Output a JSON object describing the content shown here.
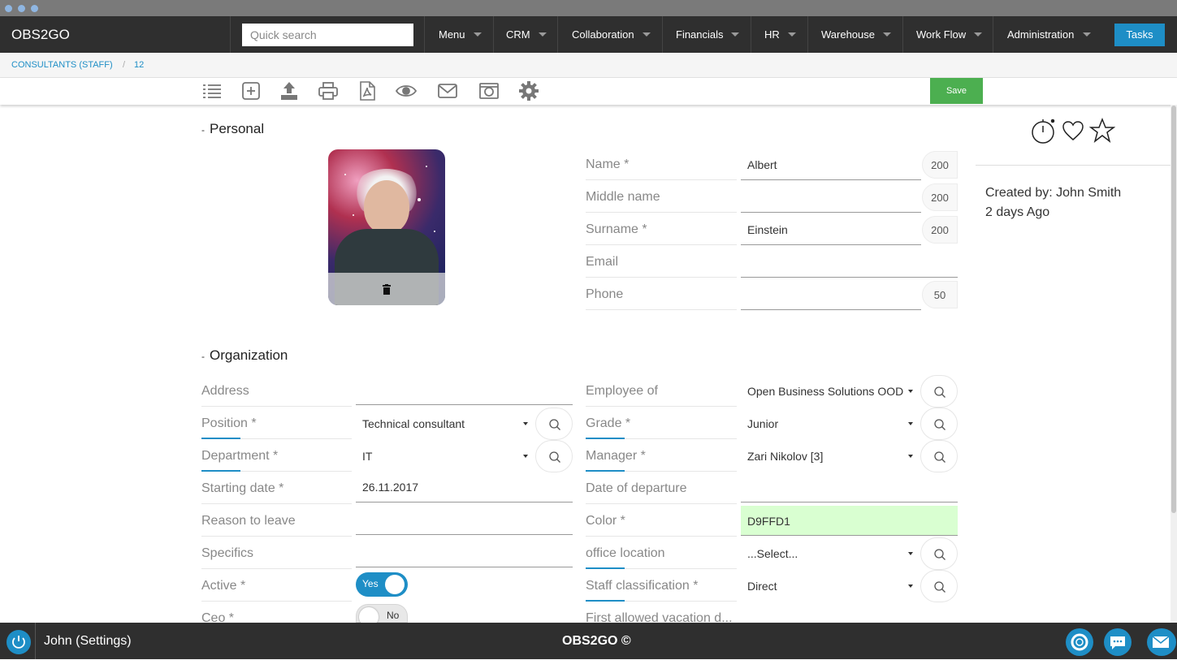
{
  "app": {
    "brand": "OBS2GO"
  },
  "search": {
    "placeholder": "Quick search"
  },
  "nav": {
    "items": [
      {
        "label": "Menu"
      },
      {
        "label": "CRM"
      },
      {
        "label": "Collaboration"
      },
      {
        "label": "Financials"
      },
      {
        "label": "HR"
      },
      {
        "label": "Warehouse"
      },
      {
        "label": "Work Flow"
      },
      {
        "label": "Administration"
      }
    ],
    "tasks_label": "Tasks"
  },
  "breadcrumb": {
    "items": [
      "CONSULTANTS (STAFF)",
      "12"
    ],
    "separator": "/"
  },
  "toolbar": {
    "icons": [
      "list-icon",
      "add-icon",
      "upload-icon",
      "print-icon",
      "pdf-icon",
      "view-icon",
      "email-icon",
      "photo-icon",
      "settings-icon"
    ],
    "save_label": "Save"
  },
  "personal": {
    "title": "Personal",
    "collapse_symbol": "-",
    "fields": {
      "name": {
        "label": "Name *",
        "value": "Albert",
        "counter": "200"
      },
      "middle": {
        "label": "Middle name",
        "value": "",
        "counter": "200"
      },
      "surname": {
        "label": "Surname *",
        "value": "Einstein",
        "counter": "200"
      },
      "email": {
        "label": "Email",
        "value": ""
      },
      "phone": {
        "label": "Phone",
        "value": "",
        "counter": "50"
      }
    }
  },
  "organization": {
    "title": "Organization",
    "collapse_symbol": "-",
    "left": {
      "address": {
        "label": "Address",
        "value": ""
      },
      "position": {
        "label": "Position *",
        "value": "Technical consultant"
      },
      "department": {
        "label": "Department *",
        "value": "IT"
      },
      "starting_date": {
        "label": "Starting date *",
        "value": "26.11.2017"
      },
      "reason": {
        "label": "Reason to leave",
        "value": ""
      },
      "specifics": {
        "label": "Specifics",
        "value": ""
      },
      "active": {
        "label": "Active *",
        "value": "Yes"
      },
      "ceo": {
        "label": "Ceo *",
        "value": "No"
      }
    },
    "right": {
      "employee_of": {
        "label": "Employee of",
        "value": "Open Business Solutions OOD"
      },
      "grade": {
        "label": "Grade *",
        "value": "Junior"
      },
      "manager": {
        "label": "Manager *",
        "value": "Zari Nikolov [3]"
      },
      "departure": {
        "label": "Date of departure",
        "value": ""
      },
      "color": {
        "label": "Color *",
        "value": "D9FFD1"
      },
      "office": {
        "label": "office location",
        "value": "...Select..."
      },
      "staff_class": {
        "label": "Staff classification *",
        "value": "Direct"
      },
      "vacation": {
        "label": "First allowed vacation d..."
      }
    }
  },
  "side": {
    "icons": [
      "stopwatch-icon",
      "heart-icon",
      "star-icon"
    ],
    "created_by": "Created by: John Smith",
    "created_ago": "2 days Ago"
  },
  "footer": {
    "user": "John (Settings)",
    "copyright": "OBS2GO ©",
    "icons": [
      "power-icon",
      "support-icon",
      "chat-icon",
      "mail-icon"
    ]
  },
  "colors": {
    "accent": "#1e8ec6",
    "save": "#4caf50",
    "nav_bg": "#2f2f2f",
    "color_field": "#D9FFD1"
  }
}
